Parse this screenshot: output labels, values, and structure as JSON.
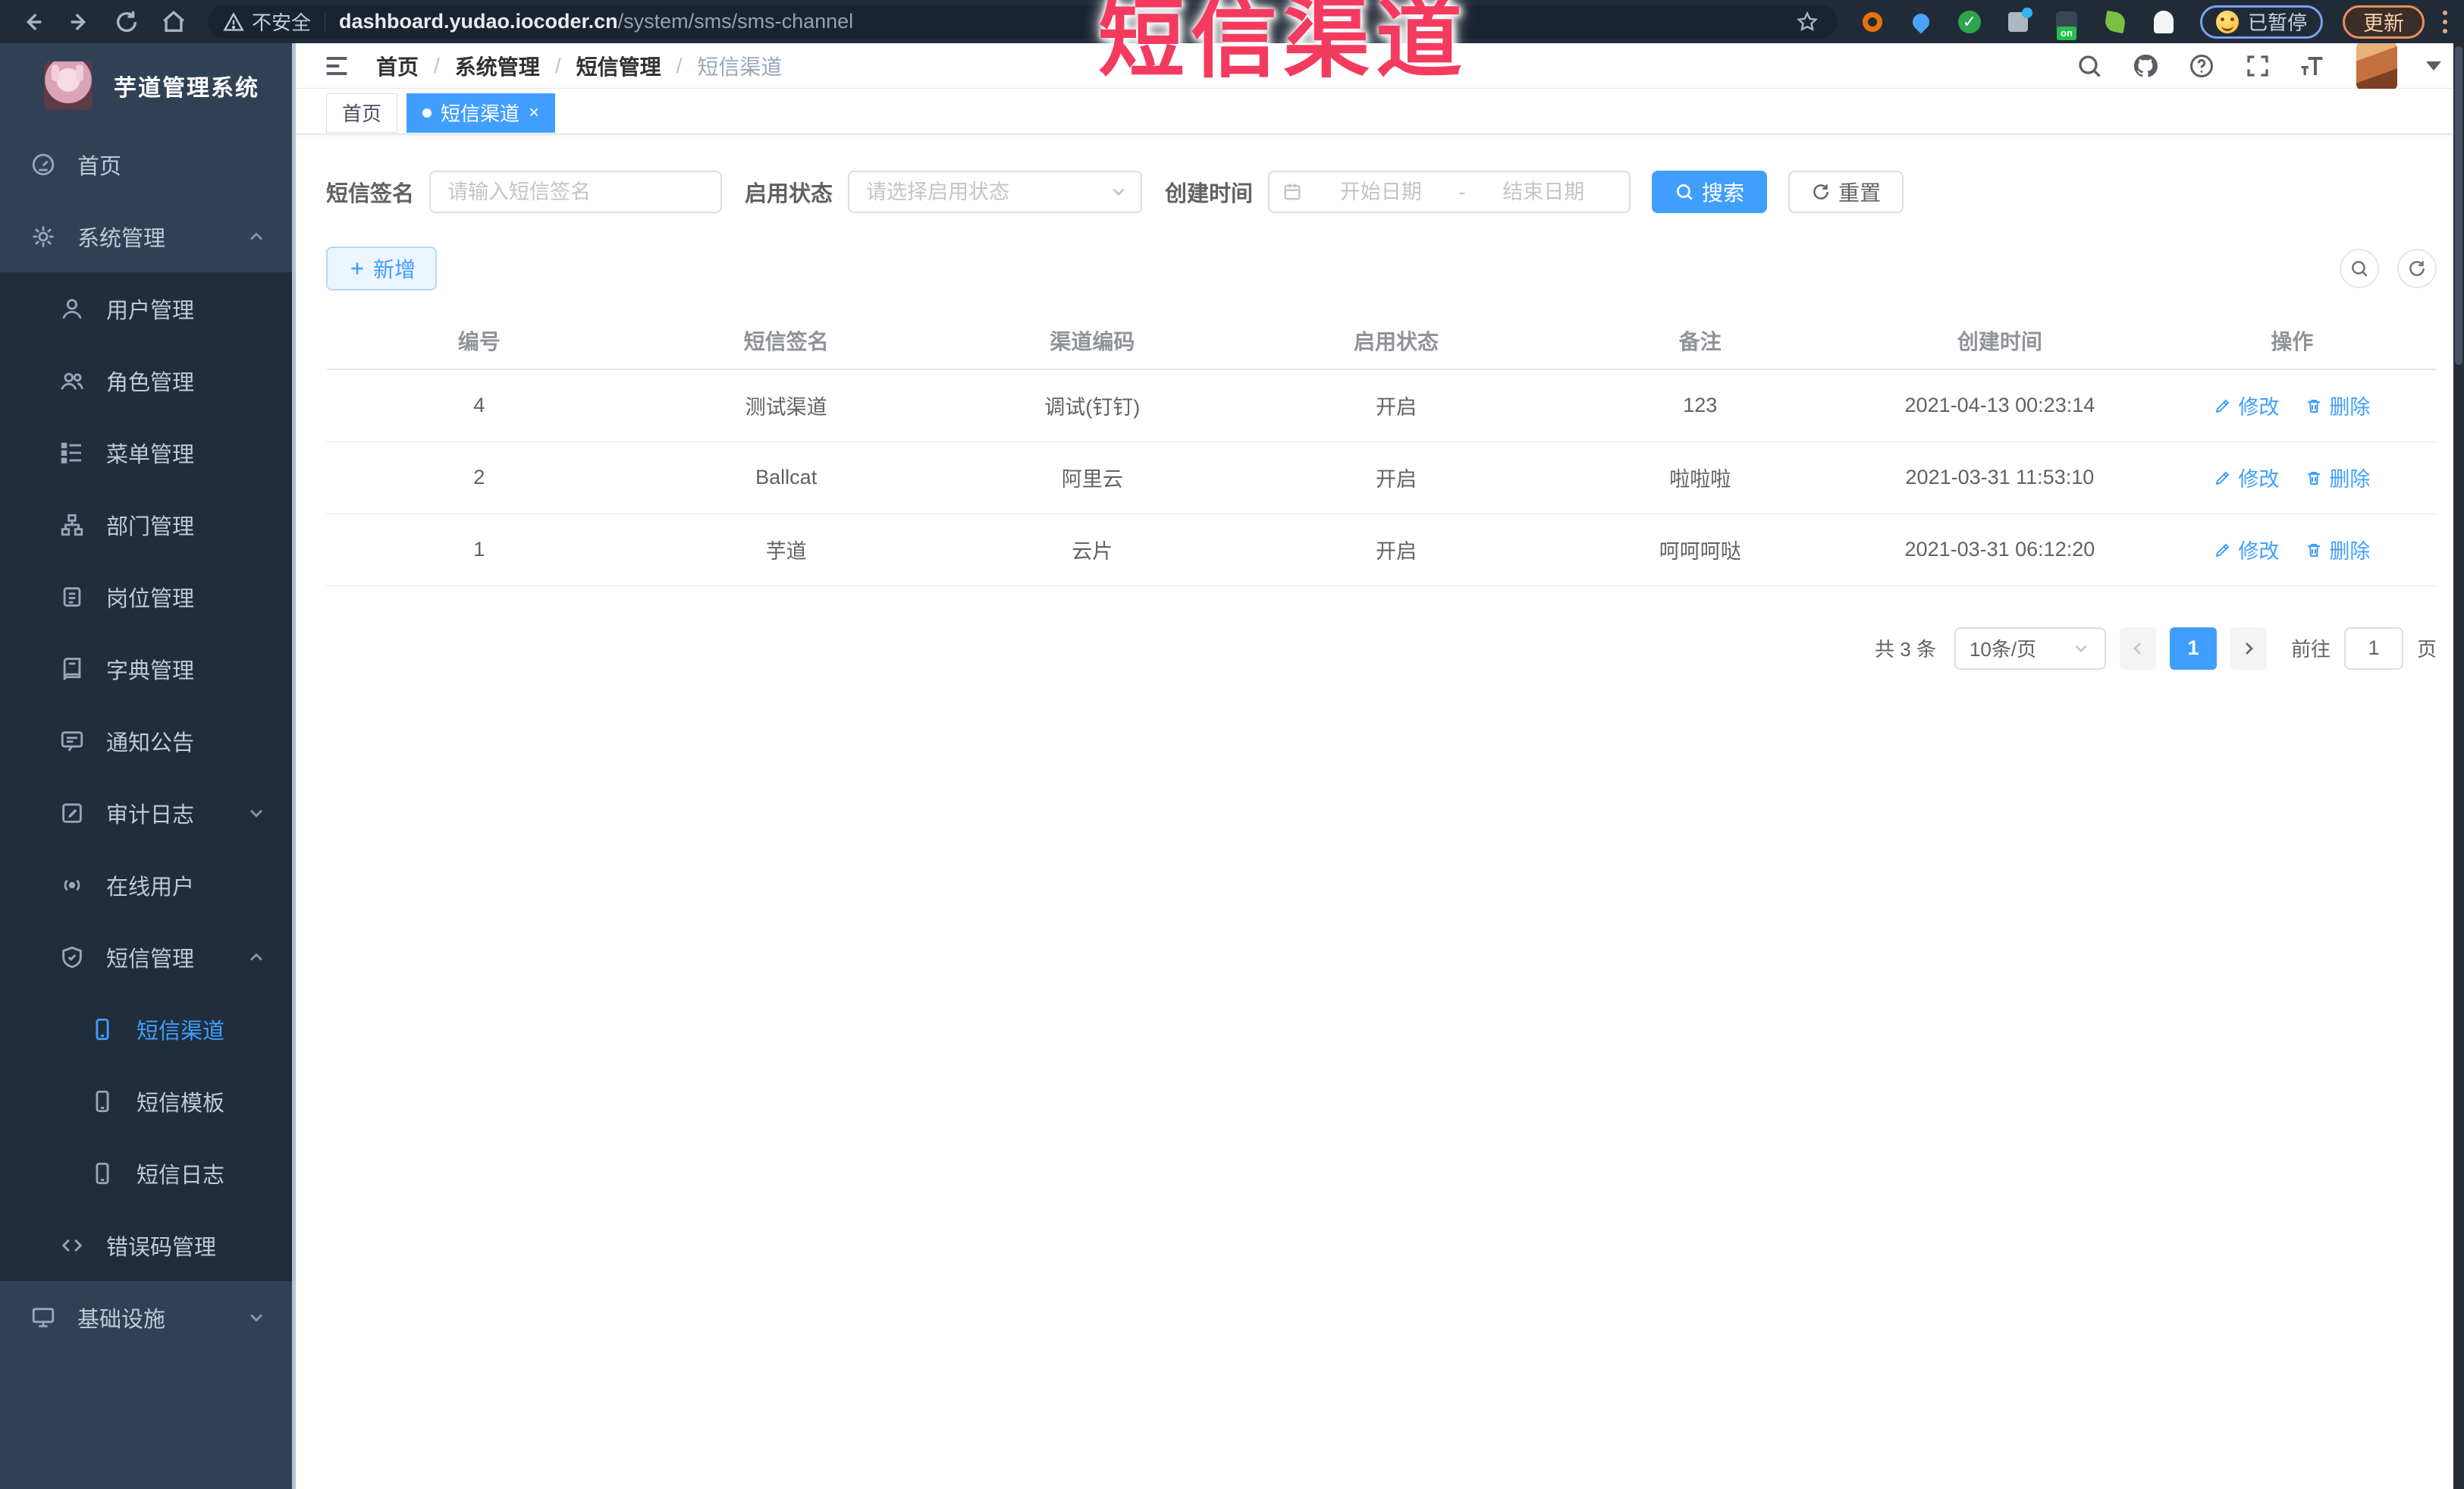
{
  "browser": {
    "security_label": "不安全",
    "url_host": "dashboard.yudao.iocoder.cn",
    "url_path": "/system/sms/sms-channel",
    "paused_label": "已暂停",
    "update_label": "更新",
    "ext_on_badge": "on"
  },
  "annotation": {
    "text": "短信渠道",
    "color": "#f43b5f"
  },
  "sidebar": {
    "title": "芋道管理系统",
    "menu": [
      {
        "label": "首页"
      },
      {
        "label": "系统管理"
      },
      {
        "label": "用户管理"
      },
      {
        "label": "角色管理"
      },
      {
        "label": "菜单管理"
      },
      {
        "label": "部门管理"
      },
      {
        "label": "岗位管理"
      },
      {
        "label": "字典管理"
      },
      {
        "label": "通知公告"
      },
      {
        "label": "审计日志"
      },
      {
        "label": "在线用户"
      },
      {
        "label": "短信管理"
      },
      {
        "label": "短信渠道"
      },
      {
        "label": "短信模板"
      },
      {
        "label": "短信日志"
      },
      {
        "label": "错误码管理"
      },
      {
        "label": "基础设施"
      }
    ]
  },
  "navbar": {
    "breadcrumb": {
      "home": "首页",
      "system": "系统管理",
      "sms": "短信管理",
      "current": "短信渠道"
    },
    "separator": "/"
  },
  "tabs": {
    "home": "首页",
    "current": "短信渠道"
  },
  "filters": {
    "sign_label": "短信签名",
    "sign_placeholder": "请输入短信签名",
    "status_label": "启用状态",
    "status_placeholder": "请选择启用状态",
    "time_label": "创建时间",
    "start_placeholder": "开始日期",
    "range_separator": "-",
    "end_placeholder": "结束日期",
    "search_label": "搜索",
    "reset_label": "重置"
  },
  "toolbar": {
    "add_label": "新增"
  },
  "table": {
    "headers": {
      "id": "编号",
      "sign": "短信签名",
      "code": "渠道编码",
      "status": "启用状态",
      "remark": "备注",
      "created": "创建时间",
      "ops": "操作"
    },
    "rows": [
      {
        "id": "4",
        "sign": "测试渠道",
        "code": "调试(钉钉)",
        "status": "开启",
        "remark": "123",
        "created": "2021-04-13 00:23:14"
      },
      {
        "id": "2",
        "sign": "Ballcat",
        "code": "阿里云",
        "status": "开启",
        "remark": "啦啦啦",
        "created": "2021-03-31 11:53:10"
      },
      {
        "id": "1",
        "sign": "芋道",
        "code": "云片",
        "status": "开启",
        "remark": "呵呵呵哒",
        "created": "2021-03-31 06:12:20"
      }
    ],
    "edit_label": "修改",
    "delete_label": "删除"
  },
  "pagination": {
    "total": "共 3 条",
    "page_size": "10条/页",
    "page": "1",
    "goto_label": "前往",
    "goto_value": "1",
    "page_unit": "页"
  },
  "colors": {
    "accent": "#409EFF",
    "sidebar_bg": "#304156",
    "submenu_bg": "#1f2d3d"
  }
}
